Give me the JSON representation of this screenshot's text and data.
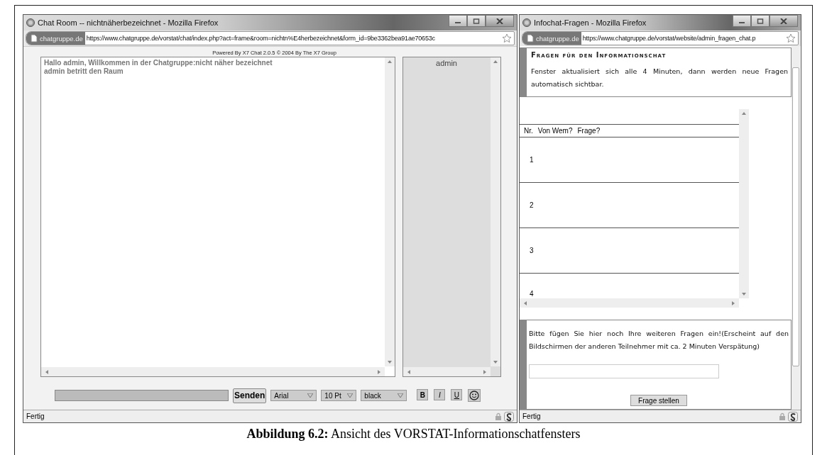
{
  "chat_window": {
    "title": "Chat Room -- nichtnäherbezeichnet - Mozilla Firefox",
    "site": "chatgruppe.de",
    "url": "https://www.chatgruppe.de/vorstat/chat/index.php?act=frame&room=nichtn%E4herbezeichnet&form_id=9be3362bea91ae70653c",
    "powered_by": "Powered By X7 Chat 2.0.5 © 2004 By The X7 Group",
    "messages": [
      "Hallo admin, Willkommen in der Chatgruppe:nicht näher bezeichnet",
      "admin betritt den Raum"
    ],
    "users": [
      "admin"
    ],
    "send_button": "Senden",
    "font_select": "Arial",
    "size_select": "10 Pt",
    "color_select": "black",
    "format_buttons": [
      {
        "kind": "bold",
        "label": "B"
      },
      {
        "kind": "italic",
        "label": "I"
      },
      {
        "kind": "underline",
        "label": "U"
      }
    ],
    "status": "Fertig"
  },
  "questions_window": {
    "title": "Infochat-Fragen - Mozilla Firefox",
    "site": "chatgruppe.de",
    "url": "https://www.chatgruppe.de/vorstat/website/admin_fragen_chat.p",
    "heading": "Fragen für den Informationschat",
    "info": "Fenster aktualisiert sich alle 4 Minuten, dann werden neue Fragen automatisch sichtbar.",
    "columns": [
      "Nr.",
      "Von Wem?",
      "Frage?"
    ],
    "rows": [
      {
        "nr": "1"
      },
      {
        "nr": "2"
      },
      {
        "nr": "3"
      },
      {
        "nr": "4"
      }
    ],
    "prompt": "Bitte fügen Sie hier noch Ihre weiteren Fragen ein!(Erscheint auf den Bildschirmen der anderen Teilnehmer mit ca. 2 Minuten Verspätung)",
    "submit_button": "Frage stellen",
    "status": "Fertig"
  },
  "caption": {
    "label": "Abbildung 6.2:",
    "text": "Ansicht des VORSTAT-Informationschatfensters"
  }
}
